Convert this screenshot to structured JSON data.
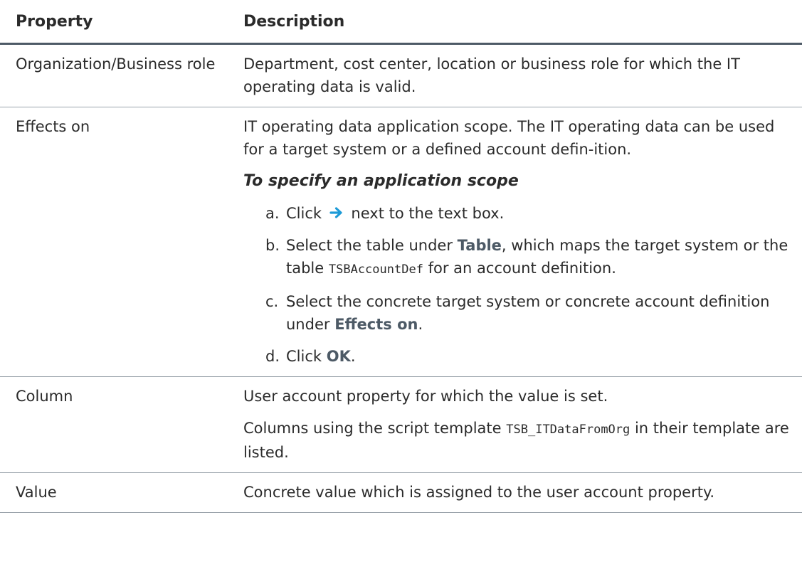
{
  "table": {
    "headers": {
      "property": "Property",
      "description": "Description"
    },
    "rows": {
      "org": {
        "property": "Organization/Business role",
        "description": "Department, cost center, location or business role for which the IT operating data is valid."
      },
      "effects": {
        "property": "Effects on",
        "description": "IT operating data application scope. The IT operating data can be used for a target system or a defined account defin-ition.",
        "procedure_title": "To specify an application scope",
        "steps": {
          "a": {
            "marker": "a.",
            "before": "Click",
            "icon": "arrow-right-icon",
            "after": "next to the text box."
          },
          "b": {
            "marker": "b.",
            "before": "Select the table under",
            "bold": "Table",
            "middle": ", which maps the target system or the table",
            "code": "TSBAccountDef",
            "after": "for an account definition."
          },
          "c": {
            "marker": "c.",
            "before": "Select the concrete target system or concrete account definition under",
            "bold": "Effects on",
            "after": "."
          },
          "d": {
            "marker": "d.",
            "before": "Click",
            "bold": "OK",
            "after": "."
          }
        }
      },
      "column": {
        "property": "Column",
        "description": "User account property for which the value is set.",
        "note_before": "Columns using the script template",
        "note_code": "TSB_ITDataFromOrg",
        "note_after": "in their template are listed."
      },
      "value": {
        "property": "Value",
        "description": "Concrete value which is assigned to the user account property."
      }
    }
  },
  "colors": {
    "text": "#2b2b2b",
    "ui_bold": "#4d5a66",
    "rule": "#4d5a66",
    "arrow": "#1e9bd7"
  }
}
